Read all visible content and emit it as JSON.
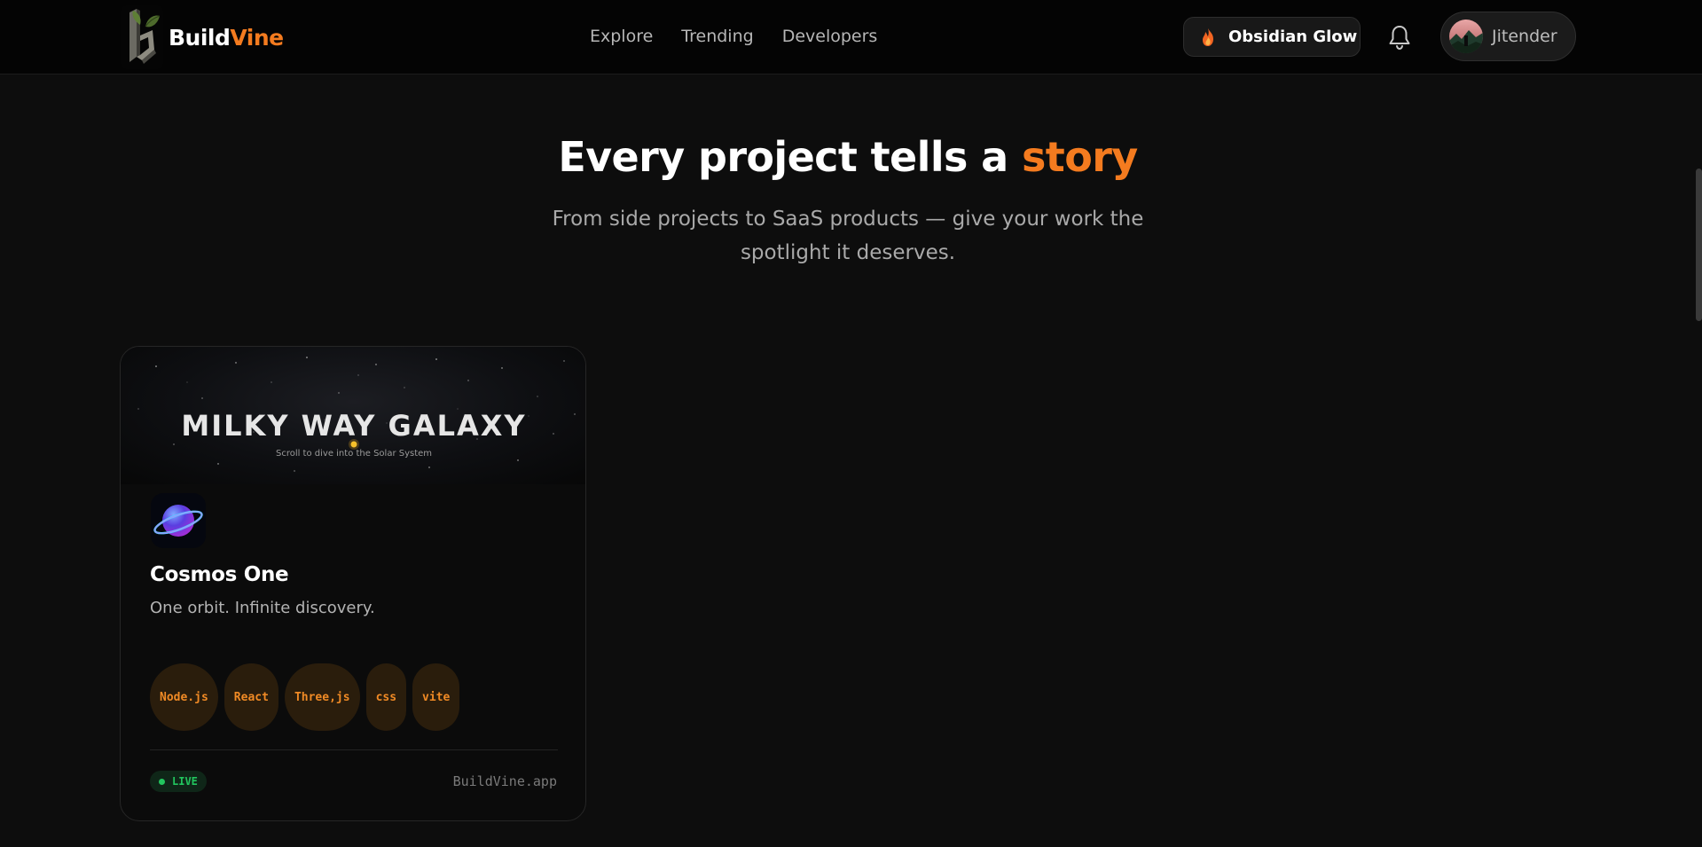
{
  "header": {
    "brand": {
      "part1": "Build",
      "part2": "Vine"
    },
    "nav": [
      "Explore",
      "Trending",
      "Developers"
    ],
    "theme_button": {
      "label": "Obsidian Glow",
      "icon": "flame-icon"
    },
    "notifications_icon": "bell-icon",
    "user": {
      "name": "Jitender"
    }
  },
  "hero": {
    "title_main": "Every project tells a ",
    "title_accent": "story",
    "subtitle": "From side projects to SaaS products — give your work the spotlight it deserves."
  },
  "project_card": {
    "cover": {
      "title": "MILKY WAY GALAXY",
      "subtitle": "Scroll to dive into the Solar System"
    },
    "icon": "planet-icon",
    "name": "Cosmos One",
    "tagline": "One orbit. Infinite discovery.",
    "tech_stack": [
      "Node.js",
      "React",
      "Three,js",
      "css",
      "vite"
    ],
    "status": "LIVE",
    "domain": "BuildVine.app"
  },
  "colors": {
    "accent": "#f47b1f",
    "background": "#0d0d0d",
    "live": "#22c55e"
  }
}
